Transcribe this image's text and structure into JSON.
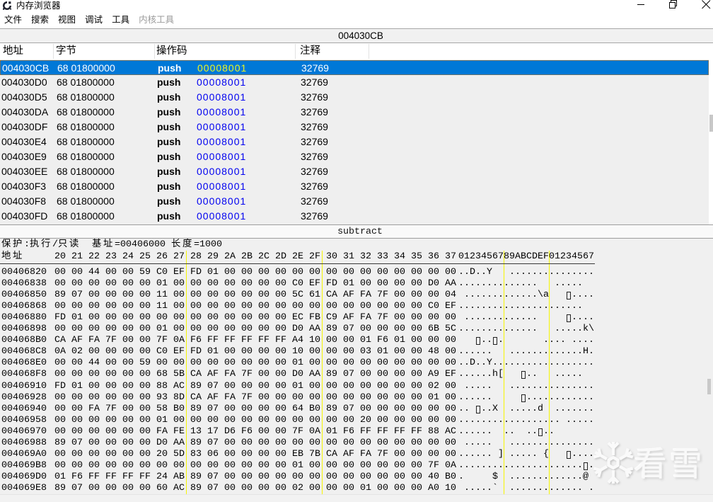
{
  "window": {
    "title": "内存浏览器",
    "controls": {
      "minimize": "minimize",
      "restore": "restore-down",
      "close": "close"
    }
  },
  "menu": {
    "items": [
      {
        "label": "文件",
        "enabled": true
      },
      {
        "label": "搜索",
        "enabled": true
      },
      {
        "label": "视图",
        "enabled": true
      },
      {
        "label": "调试",
        "enabled": true
      },
      {
        "label": "工具",
        "enabled": true
      },
      {
        "label": "内核工具",
        "enabled": false
      }
    ]
  },
  "address_bar": {
    "current_address": "004030CB"
  },
  "disassembler": {
    "columns": [
      "地址",
      "字节",
      "操作码",
      "注释"
    ],
    "selected_index": 0,
    "rows": [
      {
        "address": "004030CB",
        "bytes": "68 01800000",
        "opcode": "push",
        "operand": "00008001",
        "comment": "32769"
      },
      {
        "address": "004030D0",
        "bytes": "68 01800000",
        "opcode": "push",
        "operand": "00008001",
        "comment": "32769"
      },
      {
        "address": "004030D5",
        "bytes": "68 01800000",
        "opcode": "push",
        "operand": "00008001",
        "comment": "32769"
      },
      {
        "address": "004030DA",
        "bytes": "68 01800000",
        "opcode": "push",
        "operand": "00008001",
        "comment": "32769"
      },
      {
        "address": "004030DF",
        "bytes": "68 01800000",
        "opcode": "push",
        "operand": "00008001",
        "comment": "32769"
      },
      {
        "address": "004030E4",
        "bytes": "68 01800000",
        "opcode": "push",
        "operand": "00008001",
        "comment": "32769"
      },
      {
        "address": "004030E9",
        "bytes": "68 01800000",
        "opcode": "push",
        "operand": "00008001",
        "comment": "32769"
      },
      {
        "address": "004030EE",
        "bytes": "68 01800000",
        "opcode": "push",
        "operand": "00008001",
        "comment": "32769"
      },
      {
        "address": "004030F3",
        "bytes": "68 01800000",
        "opcode": "push",
        "operand": "00008001",
        "comment": "32769"
      },
      {
        "address": "004030F8",
        "bytes": "68 01800000",
        "opcode": "push",
        "operand": "00008001",
        "comment": "32769"
      },
      {
        "address": "004030FD",
        "bytes": "68 01800000",
        "opcode": "push",
        "operand": "00008001",
        "comment": "32769"
      }
    ]
  },
  "splitter": {
    "label": "subtract"
  },
  "hex_view": {
    "protection_line": "保护:执行/只读  基址=00406000 长度=1000",
    "address_label": "地址",
    "byte_column_labels": [
      "20",
      "21",
      "22",
      "23",
      "24",
      "25",
      "26",
      "27",
      "28",
      "29",
      "2A",
      "2B",
      "2C",
      "2D",
      "2E",
      "2F",
      "30",
      "31",
      "32",
      "33",
      "34",
      "35",
      "36",
      "37"
    ],
    "ascii_column_label": "0123456789ABCDEF01234567",
    "rows": [
      {
        "address": "00406820",
        "bytes": "00 00 44 00 00 59 C0 EF FD 01 00 00 00 00 00 00 00 00 00 00 00 00 00 00"
      },
      {
        "address": "00406838",
        "bytes": "00 00 00 00 00 00 01 00 00 00 00 00 00 00 C0 EF FD 01 00 00 00 00 D0 AA"
      },
      {
        "address": "00406850",
        "bytes": "89 07 00 00 00 00 11 00 00 00 00 00 00 00 5C 61 CA AF FA 7F 00 00 00 04"
      },
      {
        "address": "00406868",
        "bytes": "00 00 00 00 00 00 11 00 00 00 00 00 00 00 00 00 00 00 00 00 00 00 C0 EF"
      },
      {
        "address": "00406880",
        "bytes": "FD 01 00 00 00 00 00 00 00 00 00 00 00 00 EC FB C9 AF FA 7F 00 00 00 00"
      },
      {
        "address": "00406898",
        "bytes": "00 00 00 00 00 00 01 00 00 00 00 00 00 00 D0 AA 89 07 00 00 00 00 6B 5C"
      },
      {
        "address": "004068B0",
        "bytes": "CA AF FA 7F 00 00 7F 0A F6 FF FF FF FF FF A4 10 00 00 01 F6 01 00 00 00"
      },
      {
        "address": "004068C8",
        "bytes": "0A 02 00 00 00 00 C0 EF FD 01 00 00 00 00 10 00 00 00 03 01 00 00 48 00"
      },
      {
        "address": "004068E0",
        "bytes": "00 00 44 00 00 59 00 00 00 00 00 00 00 00 01 00 00 00 00 00 00 00 00 00"
      },
      {
        "address": "004068F8",
        "bytes": "00 00 00 00 00 00 68 5B CA AF FA 7F 00 00 D0 AA 89 07 00 00 00 00 A9 EF"
      },
      {
        "address": "00406910",
        "bytes": "FD 01 00 00 00 00 88 AC 89 07 00 00 00 00 01 00 00 00 00 00 00 00 02 00"
      },
      {
        "address": "00406928",
        "bytes": "00 00 00 00 00 00 93 8D CA AF FA 7F 00 00 00 00 00 00 00 00 00 00 01 00"
      },
      {
        "address": "00406940",
        "bytes": "00 00 FA 7F 00 00 58 B0 89 07 00 00 00 00 64 B0 89 07 00 00 00 00 00 00"
      },
      {
        "address": "00406958",
        "bytes": "00 00 00 00 00 00 01 00 00 00 00 00 00 00 00 00 00 00 20 00 00 00 00 00"
      },
      {
        "address": "00406970",
        "bytes": "00 00 00 00 00 00 FA FE 13 17 D6 F6 00 00 7F 0A 01 F6 FF FF FF FF 88 AC"
      },
      {
        "address": "00406988",
        "bytes": "89 07 00 00 00 00 D0 AA 89 07 00 00 00 00 00 00 00 00 00 00 00 00 00 00"
      },
      {
        "address": "004069A0",
        "bytes": "00 00 00 00 00 00 20 5D 83 06 00 00 00 00 EB 7B CA AF FA 7F 00 00 00 00"
      },
      {
        "address": "004069B8",
        "bytes": "00 00 00 00 00 00 00 00 00 00 00 00 00 00 01 00 00 00 00 00 00 00 7F 0A"
      },
      {
        "address": "004069D0",
        "bytes": "01 F6 FF FF FF FF 24 AB 89 07 00 00 00 00 00 00 00 00 00 00 00 00 40 B0"
      },
      {
        "address": "004069E8",
        "bytes": "89 07 00 00 00 00 60 AC 89 07 00 00 00 00 02 00 00 00 01 00 00 00 A0 10"
      }
    ]
  },
  "watermark": {
    "text": "看雪",
    "icon": "snowflake-icon"
  },
  "colors": {
    "selection_bg": "#0078d7",
    "selection_text": "#ffffff",
    "operand": "#0000f0",
    "operand_selected": "#eef520",
    "group_separator": "#f6f600",
    "background": "#f0f0f0"
  }
}
